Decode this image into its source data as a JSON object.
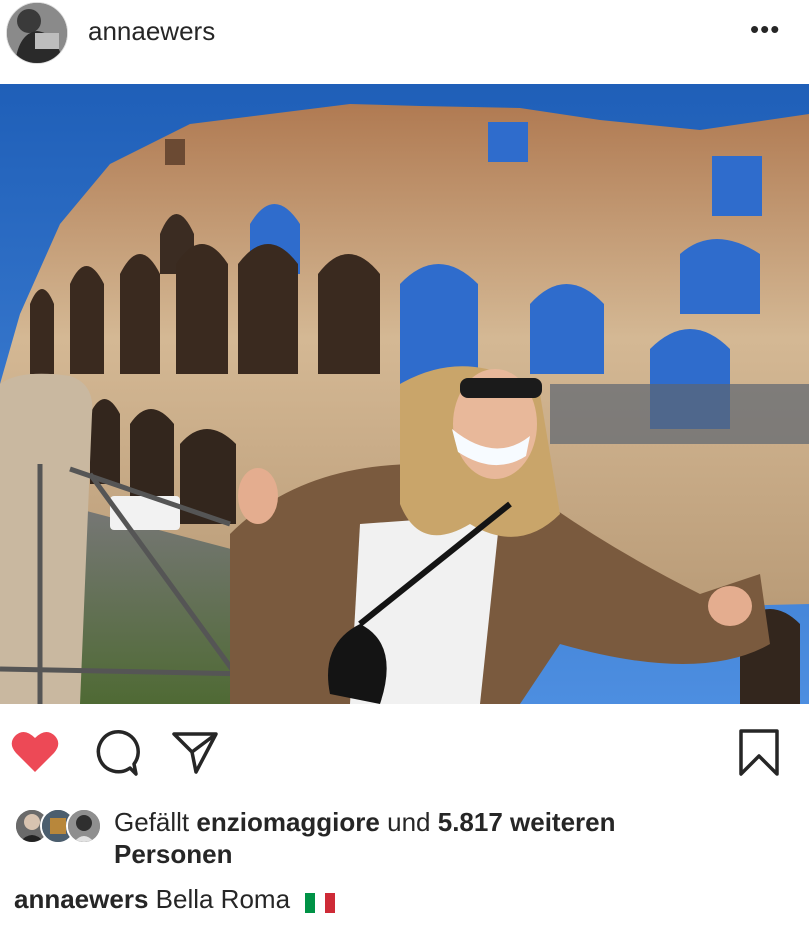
{
  "post": {
    "username": "annaewers",
    "more_icon": "more-horizontal-icon"
  },
  "photo": {
    "subject": "Colosseum photo"
  },
  "actions": {
    "like_icon": "heart-filled-icon",
    "comment_icon": "comment-icon",
    "share_icon": "send-icon",
    "save_icon": "bookmark-icon",
    "like_color": "#ed4956"
  },
  "likes": {
    "prefix": "Gefällt",
    "liked_by": "enziomaggiore",
    "conjunction": "und",
    "count": "5.817 weiteren",
    "suffix": "Personen"
  },
  "caption": {
    "username": "annaewers",
    "text": "Bella Roma",
    "emoji": "italian-flag-icon"
  }
}
